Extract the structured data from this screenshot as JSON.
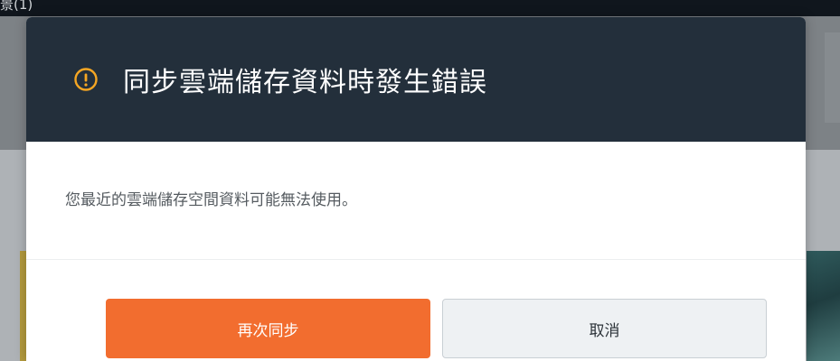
{
  "background": {
    "topbar_text": "景(1)"
  },
  "dialog": {
    "title": "同步雲端儲存資料時發生錯誤",
    "icon": "warning-circle-icon",
    "message": "您最近的雲端儲存空間資料可能無法使用。",
    "buttons": {
      "retry_label": "再次同步",
      "cancel_label": "取消"
    }
  },
  "colors": {
    "header_bg": "#232f3b",
    "warning": "#f5a623",
    "primary_button": "#f26d2f",
    "secondary_button": "#eef1f3"
  }
}
